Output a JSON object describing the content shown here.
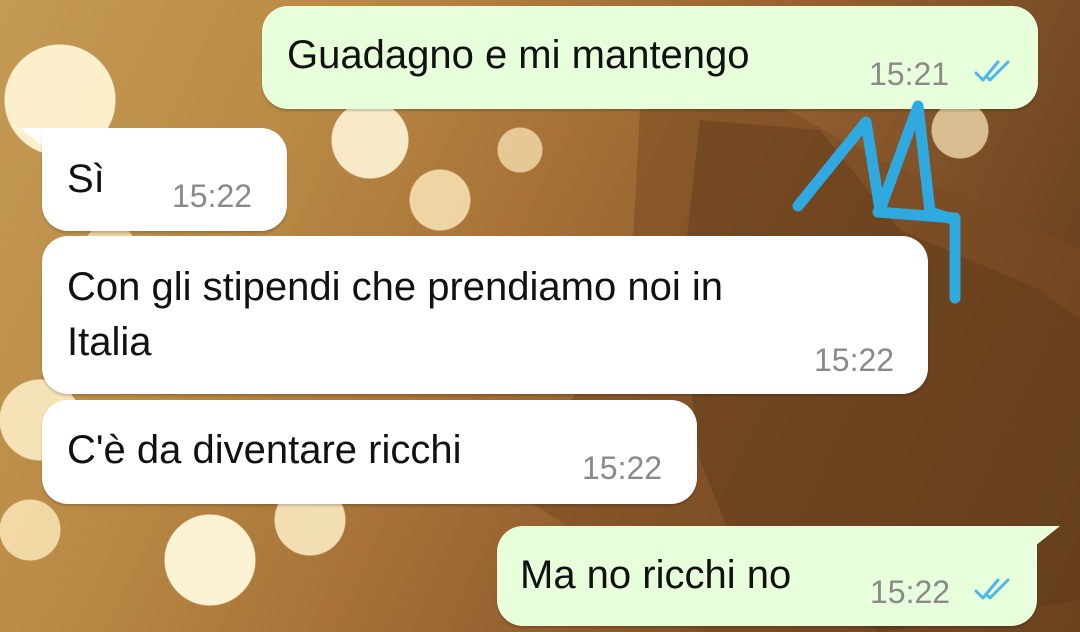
{
  "chat": {
    "messages": [
      {
        "direction": "out",
        "text": "Guadagno e mi mantengo",
        "time": "15:21",
        "status": "read"
      },
      {
        "direction": "in",
        "text": "Sì",
        "time": "15:22"
      },
      {
        "direction": "in",
        "text": "Con gli stipendi che prendiamo noi in\nItalia",
        "time": "15:22"
      },
      {
        "direction": "in",
        "text": "C'è da diventare ricchi",
        "time": "15:22"
      },
      {
        "direction": "out",
        "text": "Ma no ricchi no",
        "time": "15:22",
        "status": "read"
      }
    ]
  },
  "theme": {
    "incoming_bubble": "#ffffff",
    "outgoing_bubble": "#e7ffdb",
    "read_ticks": "#4fb6ec",
    "annotation": "#2fa9e0",
    "time_text": "#8a8a8a"
  },
  "icons": {
    "read_receipt": "double-check-icon"
  }
}
